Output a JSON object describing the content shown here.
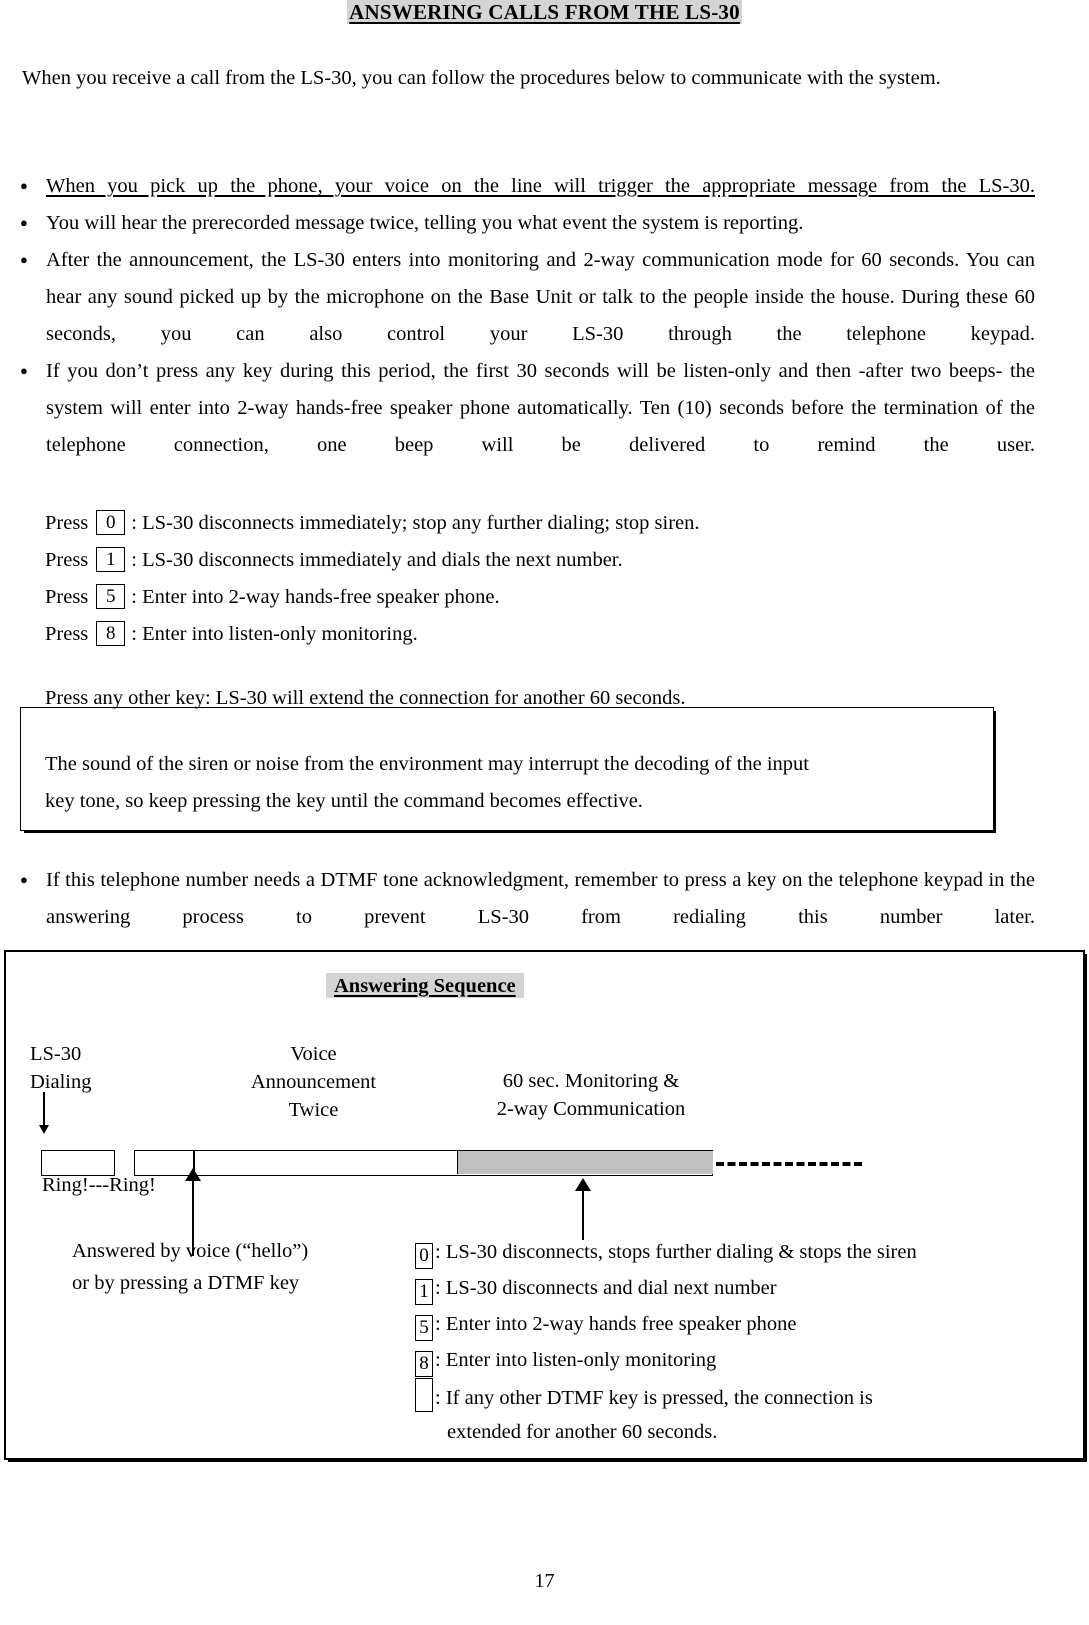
{
  "document": {
    "title": "ANSWERING CALLS FROM THE LS-30",
    "page_number": "17",
    "intro": "When you receive a call from the LS-30, you can follow the procedures below to communicate with the system.",
    "bullets": [
      "When you pick up the phone, your voice on the line will trigger the appropriate message from the LS-30.",
      "You will hear the prerecorded message twice, telling you what event the system is reporting.",
      "After the announcement, the LS-30 enters into monitoring and 2-way communication mode for 60 seconds. You can hear any sound picked up by the microphone on the Base Unit or talk to the people inside the house. During these 60 seconds, you can also control your LS-30 through the telephone keypad.",
      "If you don’t press any key during this period, the first 30 seconds will be listen-only and then -after two beeps- the system will enter into 2-way hands-free speaker phone automatically. Ten (10) seconds before the termination of the telephone connection, one beep will be delivered to remind the user."
    ],
    "press_lines": [
      {
        "prefix": "Press",
        "key": "0",
        "desc": ": LS-30 disconnects immediately; stop any further dialing; stop siren."
      },
      {
        "prefix": "Press",
        "key": "1",
        "desc": ": LS-30 disconnects immediately and dials the next number."
      },
      {
        "prefix": "Press",
        "key": "5",
        "desc": ": Enter into 2-way hands-free speaker phone."
      },
      {
        "prefix": "Press",
        "key": "8",
        "desc": ": Enter into listen-only monitoring."
      }
    ],
    "press_any": "Press any other key: LS-30 will extend the connection for another 60 seconds.",
    "note_box": {
      "line1": "The sound of the siren or noise from the environment may interrupt the decoding of the input",
      "line2": "key tone, so keep pressing the key until the command becomes effective."
    },
    "closing_bullet": "If this telephone number needs a DTMF tone acknowledgment, remember to press a key on the telephone keypad in the answering process to prevent LS-30 from redialing this number later."
  },
  "diagram": {
    "title": "Answering Sequence",
    "columns": {
      "dialing_line1": "LS-30",
      "dialing_line2": "Dialing",
      "voice_line1": "Voice",
      "voice_line2": "Announcement",
      "voice_line3": "Twice",
      "monitor_line1": "60 sec. Monitoring &",
      "monitor_line2": "2-way Communication"
    },
    "ring_text": "Ring!---Ring!",
    "answered_line1": "Answered by voice (“hello”)",
    "answered_line2": "or by pressing a DTMF key",
    "dtmf_legend": [
      {
        "key": "0",
        "desc": ": LS-30 disconnects, stops further dialing & stops the siren"
      },
      {
        "key": "1",
        "desc": ": LS-30 disconnects and dial next number"
      },
      {
        "key": "5",
        "desc": ": Enter into 2-way hands free speaker phone"
      },
      {
        "key": "8",
        "desc": ": Enter into listen-only monitoring"
      },
      {
        "key": "",
        "desc": ": If any other DTMF key is pressed, the connection is",
        "desc2": "extended for another 60 seconds."
      }
    ],
    "colors": {
      "highlight": "#d4d4d4",
      "monitoring_segment": "#c0c0c0",
      "ink": "#000000"
    }
  }
}
